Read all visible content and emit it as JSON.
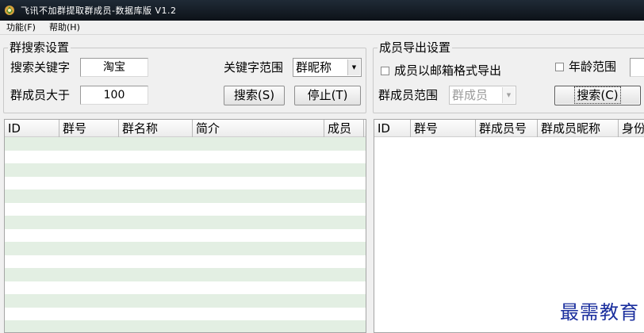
{
  "window": {
    "title": "飞讯不加群提取群成员-数据库版 V1.2"
  },
  "menu": [
    {
      "label": "功能(F)"
    },
    {
      "label": "帮助(H)"
    }
  ],
  "group_search": {
    "title": "群搜索设置",
    "keyword_label": "搜索关键字",
    "keyword_value": "淘宝",
    "scope_label": "关键字范围",
    "scope_value": "群昵称",
    "members_label": "群成员大于",
    "members_value": "100",
    "search_button": "搜索(S)",
    "stop_button": "停止(T)"
  },
  "member_export": {
    "title": "成员导出设置",
    "email_checkbox_label": "成员以邮箱格式导出",
    "age_checkbox_label": "年龄范围",
    "range_label": "群成员范围",
    "range_value": "群成员",
    "search_button": "搜索(C)"
  },
  "group_list": {
    "columns": [
      {
        "label": "ID"
      },
      {
        "label": "群号"
      },
      {
        "label": "群名称"
      },
      {
        "label": "简介"
      },
      {
        "label": "成员"
      }
    ],
    "row_count": 15,
    "stripe_color": "#e3efe3"
  },
  "member_list": {
    "columns": [
      {
        "label": "ID"
      },
      {
        "label": "群号"
      },
      {
        "label": "群成员号"
      },
      {
        "label": "群成员昵称"
      },
      {
        "label": "身份"
      }
    ]
  },
  "watermark": "最需教育",
  "colors": {
    "titlebar": "#141b23",
    "watermark": "#1b2f9e",
    "row_stripe": "#e3efe3"
  }
}
